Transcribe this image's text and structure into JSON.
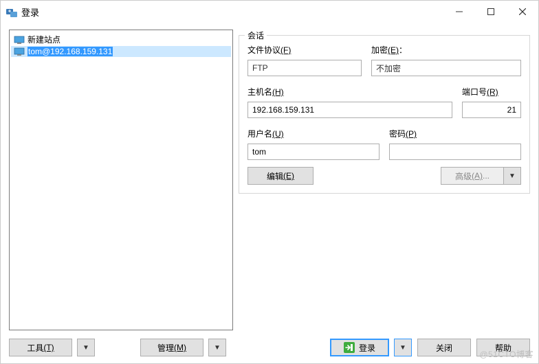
{
  "window": {
    "title": "登录"
  },
  "sites": [
    {
      "label": "新建站点",
      "selected": false
    },
    {
      "label": "tom@192.168.159.131",
      "selected": true
    }
  ],
  "session": {
    "legend": "会话",
    "protocol_label": "文件协议",
    "protocol_hotkey": "(F)",
    "protocol_value": "FTP",
    "encryption_label": "加密",
    "encryption_hotkey": "(E)",
    "encryption_suffix": "：",
    "encryption_value": "不加密",
    "host_label": "主机名",
    "host_hotkey": "(H)",
    "host_value": "192.168.159.131",
    "port_label": "端口号",
    "port_hotkey": "(R)",
    "port_value": "21",
    "user_label": "用户名",
    "user_hotkey": "(U)",
    "user_value": "tom",
    "password_label": "密码",
    "password_hotkey": "(P)",
    "password_value": "",
    "edit_button": "编辑",
    "edit_hotkey": "(E)",
    "advanced_button": "高级",
    "advanced_hotkey": "(A)",
    "advanced_suffix": "..."
  },
  "bottom": {
    "tools": "工具",
    "tools_hotkey": "(T)",
    "manage": "管理",
    "manage_hotkey": "(M)",
    "login": "登录",
    "close": "关闭",
    "help": "帮助"
  },
  "watermark": "@51CTO博客"
}
